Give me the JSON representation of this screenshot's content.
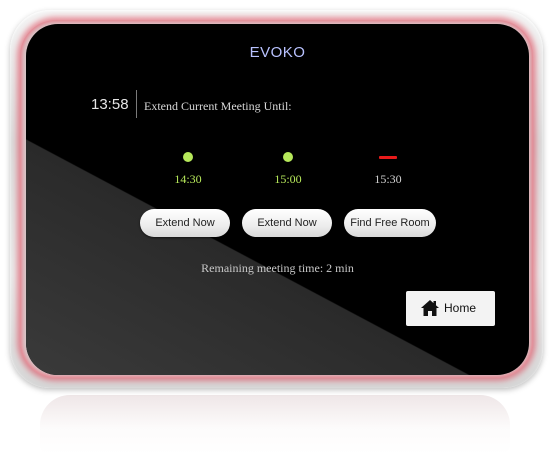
{
  "brand": "EVOKO",
  "clock": "13:58",
  "prompt": "Extend Current Meeting Until:",
  "slots": [
    {
      "time": "14:30",
      "status": "available",
      "color": "#b6e85a"
    },
    {
      "time": "15:00",
      "status": "available",
      "color": "#b6e85a"
    },
    {
      "time": "15:30",
      "status": "booked",
      "color": "#e81a1a"
    }
  ],
  "buttons": {
    "extend_1": "Extend Now",
    "extend_2": "Extend Now",
    "find_room": "Find Free Room"
  },
  "remaining": "Remaining meeting time: 2 min",
  "home": {
    "label": "Home",
    "icon": "home-icon"
  },
  "colors": {
    "available": "#b6e85a",
    "booked": "#e81a1a",
    "brand": "#b9c2ff",
    "ring": "#e0485c"
  }
}
